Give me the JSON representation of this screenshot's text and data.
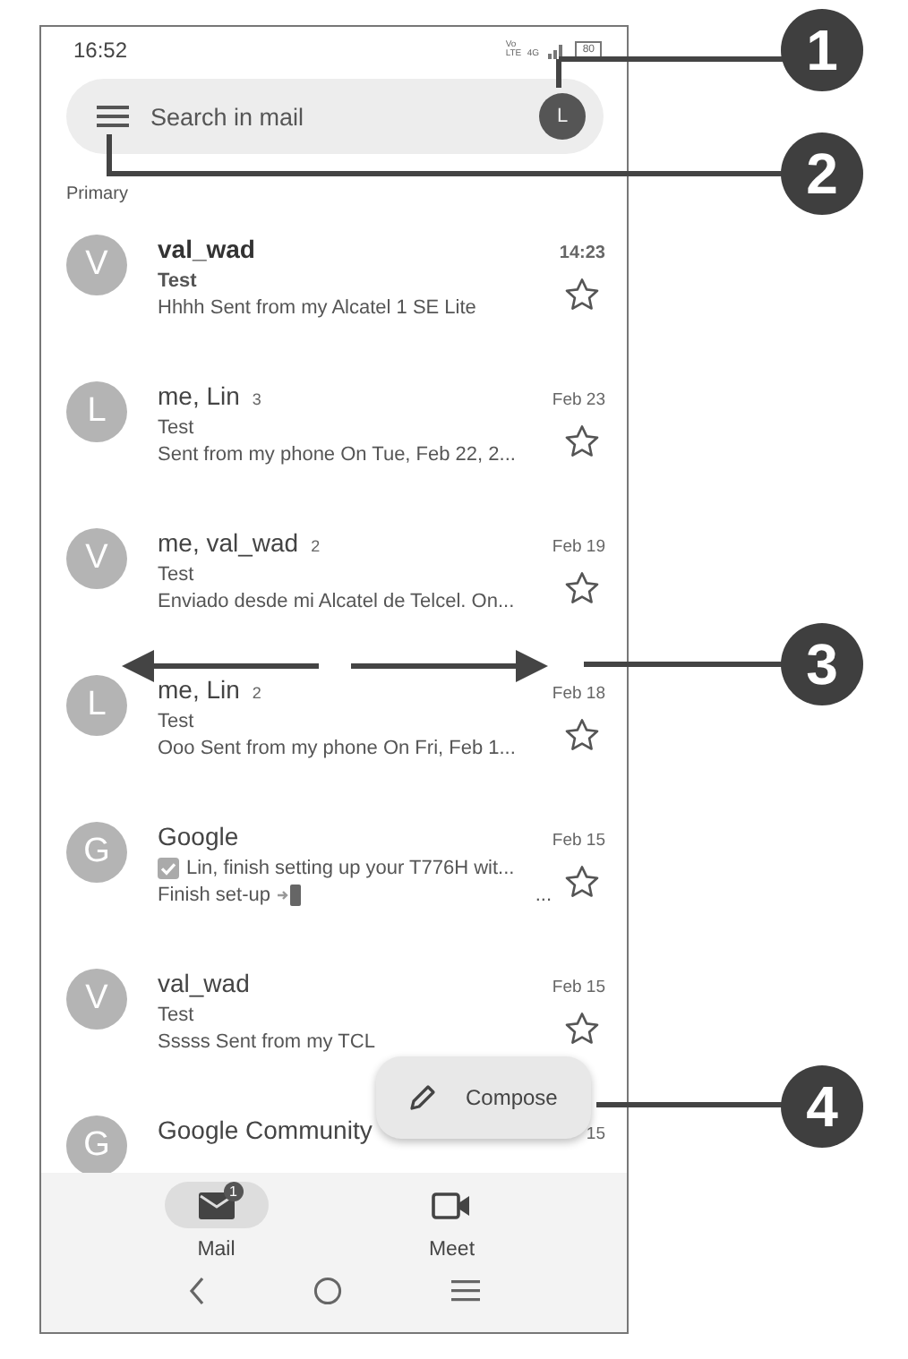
{
  "status_bar": {
    "time": "16:52",
    "volte": "Vo LTE",
    "data": "4G",
    "battery": "80"
  },
  "search": {
    "placeholder": "Search in mail",
    "avatar": "L"
  },
  "section": "Primary",
  "threads": [
    {
      "kind": "mail",
      "avatar": "V",
      "sender": "val_wad",
      "date": "14:23",
      "subject": "Test",
      "snippet": "Hhhh Sent from my Alcatel 1 SE Lite",
      "unread": true,
      "starred": false
    },
    {
      "kind": "mail",
      "avatar": "L",
      "sender": "me, Lin",
      "count": "3",
      "date": "Feb 23",
      "subject": "Test",
      "snippet": "Sent from my phone On Tue, Feb 22, 2...",
      "unread": false,
      "starred": false
    },
    {
      "kind": "mail",
      "avatar": "V",
      "sender": "me, val_wad",
      "count": "2",
      "date": "Feb 19",
      "subject": "Test",
      "snippet": "Enviado desde mi Alcatel de Telcel. On...",
      "unread": false,
      "starred": false
    },
    {
      "kind": "mail",
      "avatar": "L",
      "sender": "me, Lin",
      "count": "2",
      "date": "Feb 18",
      "subject": "Test",
      "snippet": "Ooo Sent from my phone On Fri, Feb 1...",
      "unread": false,
      "starred": false
    },
    {
      "kind": "setup",
      "avatar": "G",
      "sender": "Google",
      "date": "Feb 15",
      "subject": "Lin, finish setting up your T776H wit...",
      "snippet": "Finish set-up",
      "snippet_end": "...",
      "unread": false,
      "starred": false
    },
    {
      "kind": "mail",
      "avatar": "V",
      "sender": "val_wad",
      "date": "Feb 15",
      "subject": "Test",
      "snippet": "Sssss Sent from my TCL",
      "unread": false,
      "starred": false
    },
    {
      "kind": "partial",
      "avatar": "G",
      "sender": "Google Community",
      "date": "15"
    }
  ],
  "compose": {
    "label": "Compose"
  },
  "bottom_nav": [
    {
      "kind": "mail",
      "label": "Mail",
      "badge": "1",
      "selected": true
    },
    {
      "kind": "meet",
      "label": "Meet",
      "selected": false
    }
  ],
  "callouts": [
    {
      "number": "1"
    },
    {
      "number": "2"
    },
    {
      "number": "3"
    },
    {
      "number": "4"
    }
  ]
}
